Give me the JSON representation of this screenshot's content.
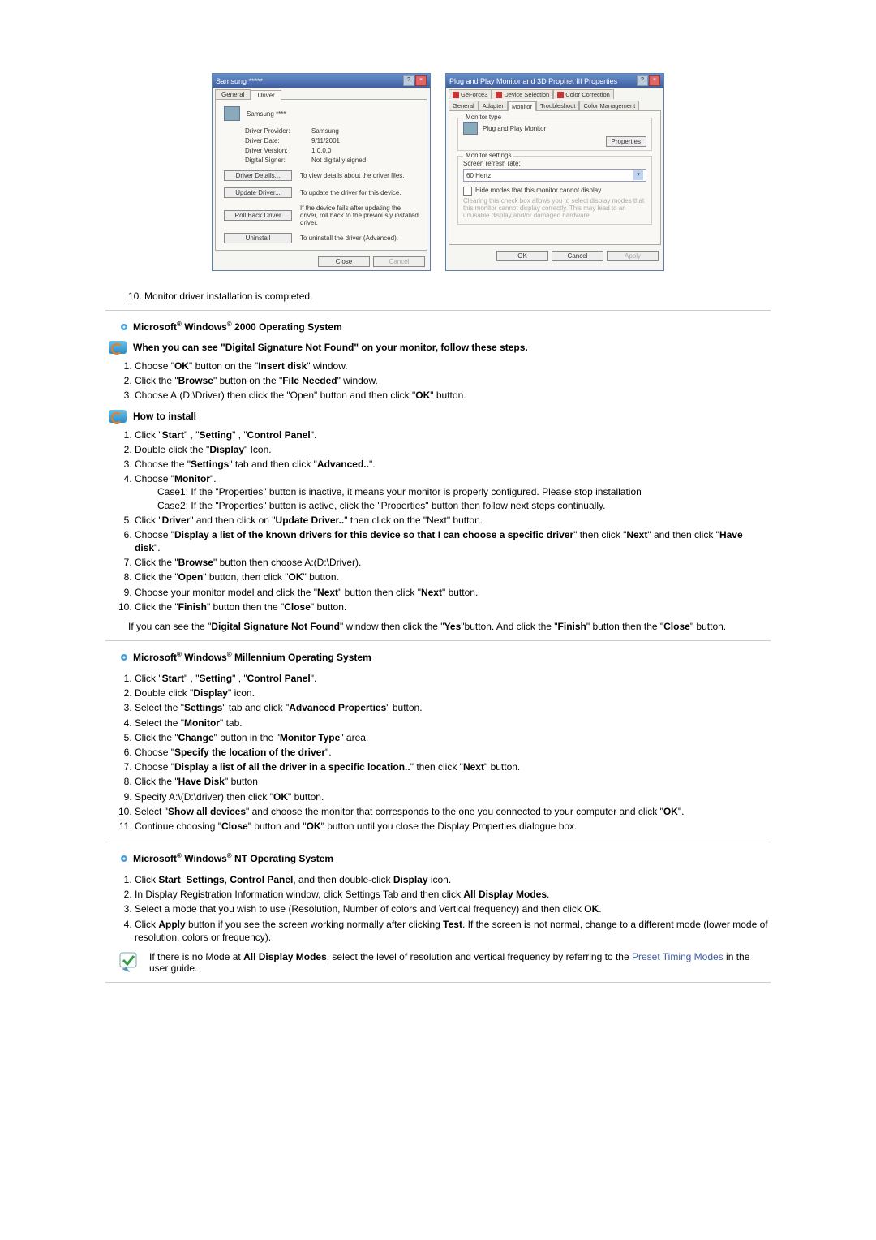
{
  "dlg1": {
    "title": "Samsung *****",
    "tab_general": "General",
    "tab_driver": "Driver",
    "device_name": "Samsung ****",
    "rows": {
      "provider_lbl": "Driver Provider:",
      "provider_val": "Samsung",
      "date_lbl": "Driver Date:",
      "date_val": "9/11/2001",
      "version_lbl": "Driver Version:",
      "version_val": "1.0.0.0",
      "signer_lbl": "Digital Signer:",
      "signer_val": "Not digitally signed"
    },
    "btns": {
      "details": "Driver Details...",
      "details_desc": "To view details about the driver files.",
      "update": "Update Driver...",
      "update_desc": "To update the driver for this device.",
      "rollback": "Roll Back Driver",
      "rollback_desc": "If the device fails after updating the driver, roll back to the previously installed driver.",
      "uninstall": "Uninstall",
      "uninstall_desc": "To uninstall the driver (Advanced).",
      "close": "Close",
      "cancel": "Cancel"
    }
  },
  "dlg2": {
    "title": "Plug and Play Monitor and 3D Prophet III Properties",
    "tabs": {
      "geforce": "GeForce3",
      "devsel": "Device Selection",
      "colorcorr": "Color Correction",
      "general": "General",
      "adapter": "Adapter",
      "monitor": "Monitor",
      "troubleshoot": "Troubleshoot",
      "colormgmt": "Color Management"
    },
    "monitor_type_legend": "Monitor type",
    "monitor_type_value": "Plug and Play Monitor",
    "properties_btn": "Properties",
    "monitor_settings_legend": "Monitor settings",
    "refresh_lbl": "Screen refresh rate:",
    "refresh_val": "60 Hertz",
    "hide_modes_lbl": "Hide modes that this monitor cannot display",
    "hide_modes_desc": "Clearing this check box allows you to select display modes that this monitor cannot display correctly. This may lead to an unusable display and/or damaged hardware.",
    "ok": "OK",
    "cancel": "Cancel",
    "apply": "Apply"
  },
  "step10": "10.   Monitor driver installation is completed.",
  "sec_2000_title_a": "Microsoft",
  "sec_2000_title_b": " Windows",
  "sec_2000_title_c": " 2000 Operating System",
  "sig_head": "When you can see \"Digital Signature Not Found\" on your monitor, follow these steps.",
  "sig_steps": [
    "Choose \"<b>OK</b>\" button on the \"<b>Insert disk</b>\" window.",
    "Click the \"<b>Browse</b>\" button on the \"<b>File Needed</b>\" window.",
    "Choose A:(D:\\Driver) then click the \"Open\" button and then click \"<b>OK</b>\" button."
  ],
  "howto_head": "How to install",
  "howto_steps": [
    "Click \"<b>Start</b>\" , \"<b>Setting</b>\" , \"<b>Control Panel</b>\".",
    "Double click the \"<b>Display</b>\" Icon.",
    "Choose the \"<b>Settings</b>\" tab and then click \"<b>Advanced..</b>\".",
    "Choose \"<b>Monitor</b>\".",
    "Click \"<b>Driver</b>\" and then click on \"<b>Update Driver..</b>\" then click on the \"Next\" button.",
    "Choose \"<b>Display a list of the known drivers for this device so that I can choose a specific driver</b>\" then click \"<b>Next</b>\" and then click \"<b>Have disk</b>\".",
    "Click the \"<b>Browse</b>\" button then choose A:(D:\\Driver).",
    "Click the \"<b>Open</b>\" button, then click \"<b>OK</b>\" button.",
    "Choose your monitor model and click the \"<b>Next</b>\" button then click \"<b>Next</b>\" button.",
    "Click the \"<b>Finish</b>\" button then the \"<b>Close</b>\" button."
  ],
  "howto_case1": "Case1: If the \"Properties\" button is inactive, it means your monitor is properly configured. Please stop installation",
  "howto_case2": "Case2: If the \"Properties\" button is active, click the \"Properties\" button then follow next steps continually.",
  "howto_tail": "If you can see the \"<b>Digital Signature Not Found</b>\" window then click the \"<b>Yes</b>\"button. And click the \"<b>Finish</b>\" button then the \"<b>Close</b>\" button.",
  "sec_me_title_c": " Millennium Operating System",
  "me_steps": [
    "Click \"<b>Start</b>\" , \"<b>Setting</b>\" , \"<b>Control Panel</b>\".",
    "Double click \"<b>Display</b>\" icon.",
    "Select the \"<b>Settings</b>\" tab and click \"<b>Advanced Properties</b>\" button.",
    "Select the \"<b>Monitor</b>\" tab.",
    "Click the \"<b>Change</b>\" button in the \"<b>Monitor Type</b>\" area.",
    "Choose \"<b>Specify the location of the driver</b>\".",
    "Choose \"<b>Display a list of all the driver in a specific location..</b>\" then click \"<b>Next</b>\" button.",
    "Click the \"<b>Have Disk</b>\" button",
    "Specify A:\\(D:\\driver) then click \"<b>OK</b>\" button.",
    "Select \"<b>Show all devices</b>\" and choose the monitor that corresponds to the one you connected to your computer and click \"<b>OK</b>\".",
    "Continue choosing \"<b>Close</b>\" button and \"<b>OK</b>\" button until you close the Display Properties dialogue box."
  ],
  "sec_nt_title_c": " NT Operating System",
  "nt_steps": [
    "Click <b>Start</b>, <b>Settings</b>, <b>Control Panel</b>, and then double-click <b>Display</b> icon.",
    "In Display Registration Information window, click Settings Tab and then click <b>All Display Modes</b>.",
    "Select a mode that you wish to use (Resolution, Number of colors and Vertical frequency) and then click <b>OK</b>.",
    "Click <b>Apply</b> button if you see the screen working normally after clicking <b>Test</b>. If the screen is not normal, change to a different mode (lower mode of resolution, colors or frequency)."
  ],
  "nt_note_a": "If there is no Mode at ",
  "nt_note_b": "All Display Modes",
  "nt_note_c": ", select the level of resolution and vertical frequency by referring to the ",
  "nt_note_link": "Preset Timing Modes",
  "nt_note_d": " in the user guide."
}
